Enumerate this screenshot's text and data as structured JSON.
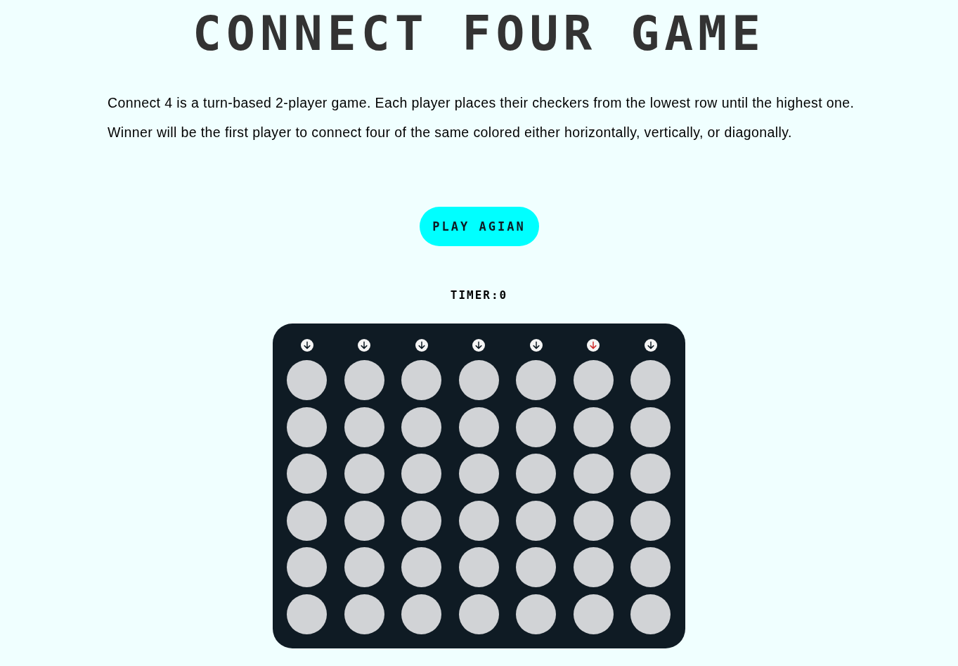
{
  "title": "CONNECT FOUR GAME",
  "description": [
    "Connect 4 is a turn-based 2-player game. Each player places their checkers from the lowest row until the highest one.",
    "Winner will be the first player to connect four of the same colored either horizontally, vertically, or diagonally."
  ],
  "button": {
    "label": "PLAY AGIAN"
  },
  "timer": {
    "text": "TIMER:0"
  },
  "board": {
    "drop_buttons": [
      {
        "selected": false
      },
      {
        "selected": false
      },
      {
        "selected": false
      },
      {
        "selected": false
      },
      {
        "selected": false
      },
      {
        "selected": true
      },
      {
        "selected": false
      }
    ],
    "rows": [
      [
        {
          "kind": "empty"
        },
        {
          "kind": "empty"
        },
        {
          "kind": "empty"
        },
        {
          "kind": "empty"
        },
        {
          "kind": "empty"
        },
        {
          "kind": "empty"
        },
        {
          "kind": "empty"
        }
      ],
      [
        {
          "kind": "empty"
        },
        {
          "kind": "empty"
        },
        {
          "kind": "empty"
        },
        {
          "kind": "empty"
        },
        {
          "kind": "empty"
        },
        {
          "kind": "empty"
        },
        {
          "kind": "empty"
        }
      ],
      [
        {
          "kind": "empty"
        },
        {
          "kind": "empty"
        },
        {
          "kind": "empty"
        },
        {
          "kind": "empty"
        },
        {
          "kind": "empty"
        },
        {
          "kind": "empty"
        },
        {
          "kind": "empty"
        }
      ],
      [
        {
          "kind": "empty"
        },
        {
          "kind": "empty"
        },
        {
          "kind": "empty"
        },
        {
          "kind": "empty"
        },
        {
          "kind": "empty"
        },
        {
          "kind": "empty"
        },
        {
          "kind": "empty"
        }
      ],
      [
        {
          "kind": "empty"
        },
        {
          "kind": "empty"
        },
        {
          "kind": "empty"
        },
        {
          "kind": "empty"
        },
        {
          "kind": "empty"
        },
        {
          "kind": "empty"
        },
        {
          "kind": "empty"
        }
      ],
      [
        {
          "kind": "empty"
        },
        {
          "kind": "empty"
        },
        {
          "kind": "empty"
        },
        {
          "kind": "empty"
        },
        {
          "kind": "empty"
        },
        {
          "kind": "empty"
        },
        {
          "kind": "empty"
        }
      ]
    ]
  }
}
